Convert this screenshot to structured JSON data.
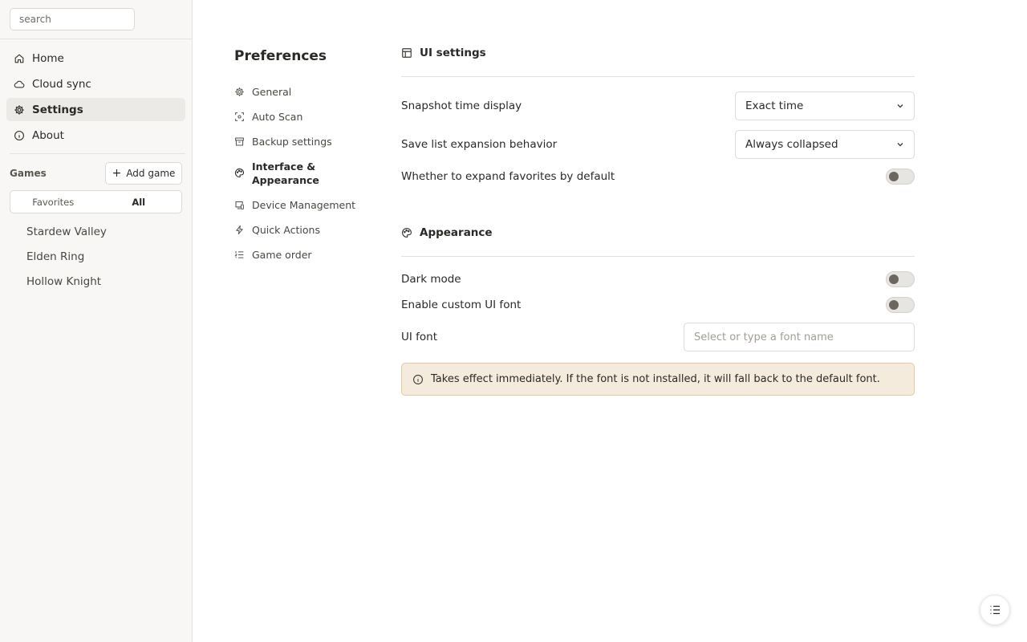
{
  "sidebar": {
    "search_placeholder": "search",
    "nav": [
      {
        "label": "Home",
        "icon": "home-icon"
      },
      {
        "label": "Cloud sync",
        "icon": "cloud-icon"
      },
      {
        "label": "Settings",
        "icon": "gear-icon",
        "active": true
      },
      {
        "label": "About",
        "icon": "info-icon"
      }
    ],
    "games_label": "Games",
    "add_game_label": "Add game",
    "filter": {
      "favorites": "Favorites",
      "all": "All",
      "selected": "All"
    },
    "games": [
      "Stardew Valley",
      "Elden Ring",
      "Hollow Knight"
    ]
  },
  "preferences": {
    "title": "Preferences",
    "items": [
      {
        "label": "General",
        "icon": "gear-icon"
      },
      {
        "label": "Auto Scan",
        "icon": "scan-icon"
      },
      {
        "label": "Backup settings",
        "icon": "archive-icon"
      },
      {
        "label": "Interface & Appearance",
        "icon": "palette-icon",
        "active": true
      },
      {
        "label": "Device Management",
        "icon": "devices-icon"
      },
      {
        "label": "Quick Actions",
        "icon": "lightning-icon"
      },
      {
        "label": "Game order",
        "icon": "list-order-icon"
      }
    ]
  },
  "ui_settings": {
    "heading": "UI settings",
    "snapshot_label": "Snapshot time display",
    "snapshot_value": "Exact time",
    "expansion_label": "Save list expansion behavior",
    "expansion_value": "Always collapsed",
    "expand_favorites_label": "Whether to expand favorites by default",
    "expand_favorites_on": false
  },
  "appearance": {
    "heading": "Appearance",
    "dark_mode_label": "Dark mode",
    "dark_mode_on": false,
    "custom_font_label": "Enable custom UI font",
    "custom_font_on": false,
    "ui_font_label": "UI font",
    "ui_font_placeholder": "Select or type a font name",
    "notice": "Takes effect immediately. If the font is not installed, it will fall back to the default font."
  },
  "colors": {
    "sidebar_bg": "#f8f7f5",
    "active_nav_bg": "#eceae6",
    "notice_bg": "#f5ebdc",
    "notice_border": "#e5c9a3",
    "toggle_knob": "#6b675f"
  }
}
